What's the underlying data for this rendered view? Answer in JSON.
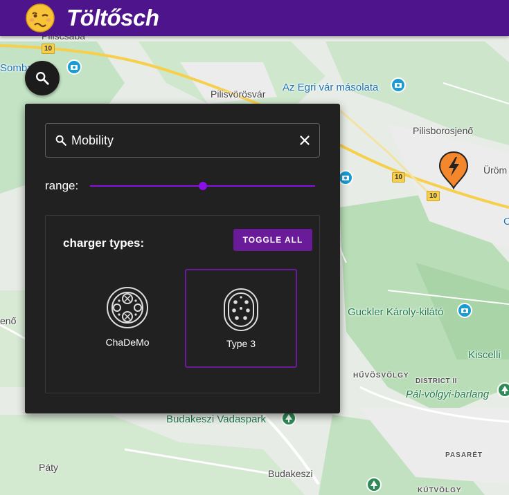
{
  "app": {
    "title": "Töltősch"
  },
  "search": {
    "value": "Mobility",
    "placeholder": ""
  },
  "range": {
    "label": "range:",
    "value_fraction": 0.5
  },
  "charger_types": {
    "title": "charger types:",
    "toggle_all_label": "TOGGLE ALL",
    "items": [
      {
        "label": "ChaDeMo",
        "selected": false
      },
      {
        "label": "Type 3",
        "selected": true
      }
    ]
  },
  "colors": {
    "header": "#4d148c",
    "accent": "#8b10e8",
    "button": "#6a1b9a",
    "panel": "#212121",
    "marker": "#f4862b"
  },
  "map": {
    "labels": {
      "pilisvorosvar": "Pilisvörösvár",
      "pilisborosjeno": "Pilisborosjenő",
      "egri_var": "Az Egri vár másolata",
      "urom": "Üröm",
      "guckler": "Guckler Károly-kilátó",
      "kiscelli": "Kiscelli",
      "huvosvolgy": "HŰVÖSVÖLGY",
      "district": "DISTRICT II",
      "pal_volgyi": "Pál-völgyi-barlang",
      "vadaspark": "Budakeszi Vadaspark",
      "pasaret": "PASARÉT",
      "paty": "Páty",
      "budakeszi": "Budakeszi",
      "kutvolgy": "KÚTVÖLGY",
      "pilicsaba": "Piliscsaba",
      "somba": "Somba",
      "eno": "enő",
      "c": "C"
    },
    "road_numbers": [
      "10",
      "10",
      "10"
    ]
  }
}
